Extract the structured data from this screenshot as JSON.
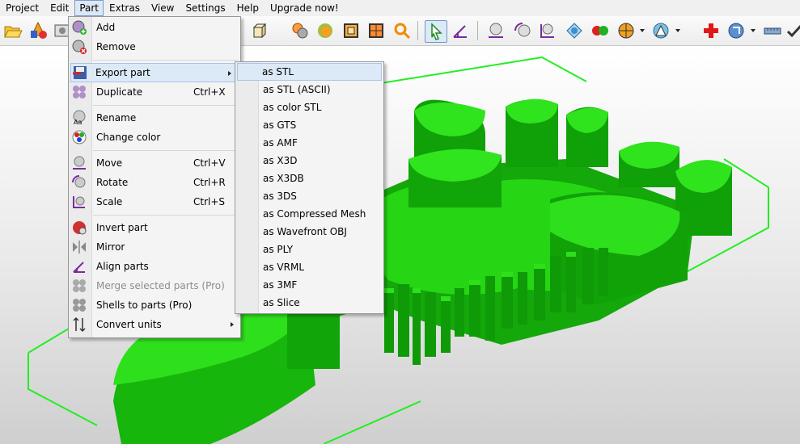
{
  "menubar": {
    "items": [
      "Project",
      "Edit",
      "Part",
      "Extras",
      "View",
      "Settings",
      "Help",
      "Upgrade now!"
    ],
    "active": "Part"
  },
  "toolbar": {
    "icons": [
      "open-folder-icon",
      "add-shapes-icon",
      "screenshot-icon",
      "box-wireframe-icon",
      "box-solid-icon",
      "spheres-icon",
      "sphere-orange-icon",
      "cube-frame-icon",
      "cube-mesh-icon",
      "zoom-icon",
      "select-pointer-icon",
      "align-icon",
      "move-icon",
      "rotate-icon",
      "scale-icon",
      "measure-icon",
      "two-balls-icon",
      "color-wheel-icon",
      "shading-icon",
      "repair-plus-icon",
      "analysis-icon",
      "ruler-icon",
      "check-icon"
    ]
  },
  "part_menu": {
    "items": [
      {
        "label": "Add",
        "shortcut": "",
        "icon": "add-sphere-icon"
      },
      {
        "label": "Remove",
        "shortcut": "",
        "icon": "remove-sphere-icon"
      },
      {
        "separator": true
      },
      {
        "label": "Export part",
        "shortcut": "",
        "icon": "floppy-export-icon",
        "submenu": true
      },
      {
        "label": "Duplicate",
        "shortcut": "Ctrl+X",
        "icon": "duplicate-icon"
      },
      {
        "separator": true
      },
      {
        "label": "Rename",
        "shortcut": "",
        "icon": "rename-icon"
      },
      {
        "label": "Change color",
        "shortcut": "",
        "icon": "color-icon"
      },
      {
        "separator": true
      },
      {
        "label": "Move",
        "shortcut": "Ctrl+V",
        "icon": "move-icon"
      },
      {
        "label": "Rotate",
        "shortcut": "Ctrl+R",
        "icon": "rotate-icon"
      },
      {
        "label": "Scale",
        "shortcut": "Ctrl+S",
        "icon": "scale-icon"
      },
      {
        "separator": true
      },
      {
        "label": "Invert part",
        "shortcut": "",
        "icon": "invert-icon"
      },
      {
        "label": "Mirror",
        "shortcut": "",
        "icon": "mirror-icon"
      },
      {
        "label": "Align parts",
        "shortcut": "",
        "icon": "align-icon"
      },
      {
        "label": "Merge selected parts (Pro)",
        "shortcut": "",
        "icon": "merge-icon",
        "disabled": true
      },
      {
        "label": "Shells to parts (Pro)",
        "shortcut": "",
        "icon": "shells-icon"
      },
      {
        "label": "Convert units",
        "shortcut": "",
        "icon": "convert-units-icon",
        "submenu": true
      }
    ]
  },
  "export_submenu": {
    "items": [
      "as STL",
      "as STL (ASCII)",
      "as color STL",
      "as GTS",
      "as AMF",
      "as X3D",
      "as X3DB",
      "as 3DS",
      "as Compressed Mesh",
      "as Wavefront OBJ",
      "as PLY",
      "as VRML",
      "as 3MF",
      "as Slice"
    ]
  },
  "colors": {
    "model_green": "#1fd20f",
    "bbox_green": "#22ee22",
    "menu_hover": "#dce9f7"
  }
}
